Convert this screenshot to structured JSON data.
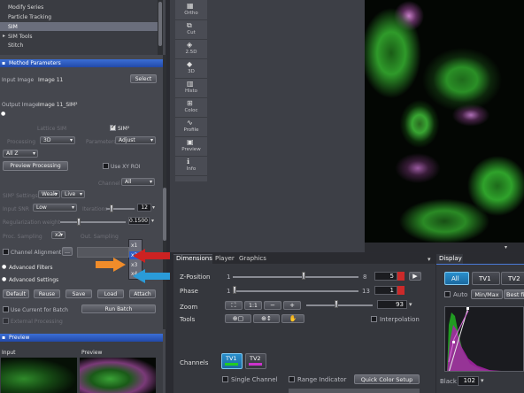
{
  "tree": {
    "items": [
      "Modify Series",
      "Particle Tracking",
      "SIM",
      "SIM Tools",
      "Stitch"
    ],
    "selected": "SIM"
  },
  "method_parameters": {
    "title": "Method Parameters",
    "input_label": "Input Image",
    "input_value": "Image 11",
    "select_label": "Select",
    "output_label": "Output Image",
    "output_value": "Image 11_SIM²",
    "lattice_sim": "Lattice SIM",
    "sim2": "SIM²",
    "processing_label": "Processing",
    "processing_value": "3D",
    "parameters_label": "Parameters",
    "parameters_value": "Adjust",
    "z_value": "All Z",
    "preview_processing": "Preview Processing",
    "use_xy_roi": "Use XY ROI",
    "channel_label": "Channel",
    "channel_value": "All",
    "sim_settings_label": "SIM² Settings",
    "sim_settings_value1": "Weak",
    "sim_settings_value2": "Live",
    "input_snr_label": "Input SNR",
    "input_snr_value": "Low",
    "iterations_label": "Iterations",
    "iterations_value": "12",
    "reg_weight_label": "Regularization weight",
    "reg_weight_value": "0.1500",
    "proc_sampling_label": "Proc. Sampling",
    "proc_sampling_value": "x2",
    "out_sampling_label": "Out. Sampling",
    "out_sampling_value": "x2",
    "sampling_options": [
      "x1",
      "x2",
      "x3",
      "x4"
    ],
    "channel_alignment": "Channel Alignment",
    "advanced_filters": "Advanced Filters",
    "advanced_settings": "Advanced Settings",
    "btn_default": "Default",
    "btn_reuse": "Reuse",
    "btn_save": "Save",
    "btn_load": "Load",
    "btn_attach": "Attach",
    "use_current_for_batch": "Use Current for Batch",
    "run_batch": "Run Batch",
    "external_processing": "External Processing"
  },
  "preview": {
    "title": "Preview",
    "input": "Input",
    "preview": "Preview"
  },
  "view_tabs": [
    "Ortho",
    "Cut",
    "2.5D",
    "3D",
    "Histo",
    "Coloc",
    "Profile",
    "Preview",
    "Info"
  ],
  "bottom": {
    "tabs": [
      "Dimensions",
      "Player",
      "Graphics"
    ],
    "z_position_label": "Z-Position",
    "z_min": "1",
    "z_max": "8",
    "z_value": "5",
    "phase_label": "Phase",
    "phase_min": "1",
    "phase_max": "13",
    "phase_value": "1",
    "zoom_label": "Zoom",
    "zoom_value": "93",
    "tools_label": "Tools",
    "interpolation": "Interpolation",
    "channels_label": "Channels",
    "channel_buttons": [
      "TV1",
      "TV2"
    ],
    "single_channel": "Single Channel",
    "range_indicator": "Range Indicator",
    "quick_color_setup": "Quick Color Setup",
    "zoom_icons": [
      "fit-icon",
      "100-icon",
      "zoom-out-icon",
      "zoom-in-icon"
    ],
    "zoom_icon_labels": [
      "⛶",
      "1:1",
      "−",
      "+"
    ]
  },
  "display": {
    "title": "Display",
    "channel_tabs": [
      "All",
      "TV1",
      "TV2"
    ],
    "auto": "Auto",
    "min_max": "Min/Max",
    "best_fit": "Best fit",
    "black_label": "Black",
    "black_value": "102"
  },
  "colors": {
    "orange_arrow": "#f08c2a",
    "red_arrow": "#cc2222",
    "blue_arrow": "#2a9bd8",
    "accent": "#2f5fc6"
  }
}
